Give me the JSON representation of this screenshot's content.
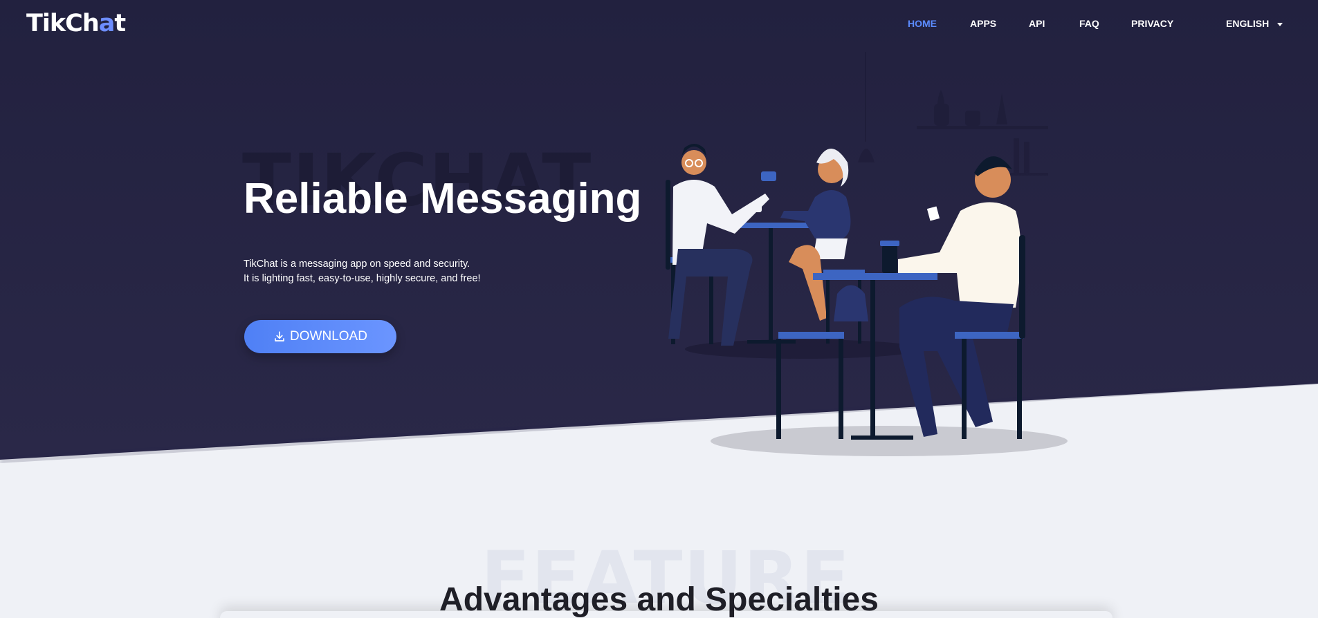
{
  "brand": {
    "logo_main": "TikCh",
    "logo_accent": "a",
    "logo_end": "t",
    "accent_color": "#6d8dff"
  },
  "nav": {
    "items": [
      {
        "label": "HOME",
        "active": true
      },
      {
        "label": "APPS",
        "active": false
      },
      {
        "label": "API",
        "active": false
      },
      {
        "label": "FAQ",
        "active": false
      },
      {
        "label": "PRIVACY",
        "active": false
      }
    ],
    "language": "ENGLISH"
  },
  "hero": {
    "watermark": "TIKCHAT",
    "title": "Reliable Messaging",
    "desc_line1": "TikChat is a messaging app on speed and security.",
    "desc_line2": "It is lighting fast, easy-to-use, highly secure, and free!",
    "download_label": "DOWNLOAD",
    "download_icon": "download-icon",
    "button_color": "#5b8bff"
  },
  "features": {
    "watermark": "FEATURE",
    "title": "Advantages and Specialties"
  }
}
